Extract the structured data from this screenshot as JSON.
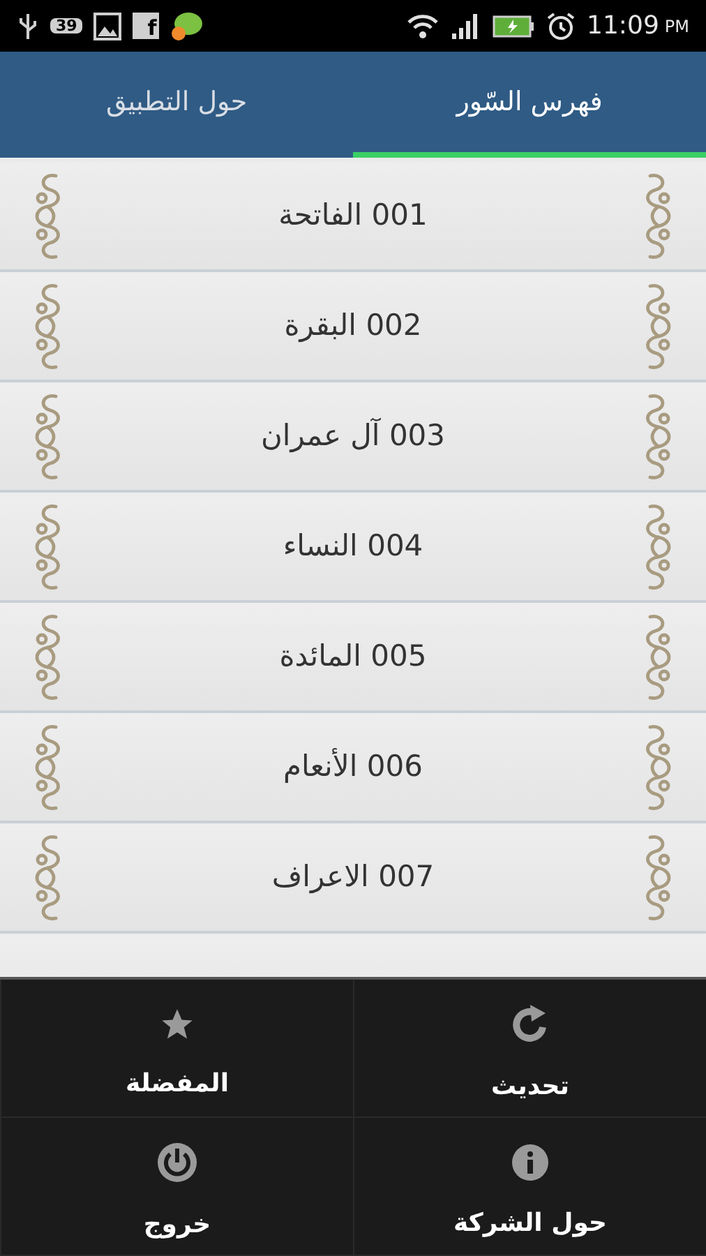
{
  "status_bar": {
    "notification_count": "39",
    "app_letter": "f",
    "time": "11:09",
    "period": "PM"
  },
  "tabs": [
    {
      "label": "فهرس السّور",
      "selected": true
    },
    {
      "label": "حول التطبيق",
      "selected": false
    }
  ],
  "surahs": [
    "001 الفاتحة",
    "002 البقرة",
    "003 آل عمران",
    "004 النساء",
    "005 المائدة",
    "006 الأنعام",
    "007 الاعراف"
  ],
  "menu": [
    {
      "label": "تحديث",
      "kind": "refresh"
    },
    {
      "label": "المفضلة",
      "kind": "favorites"
    },
    {
      "label": "حول الشركة",
      "kind": "info"
    },
    {
      "label": "خروج",
      "kind": "exit"
    }
  ]
}
